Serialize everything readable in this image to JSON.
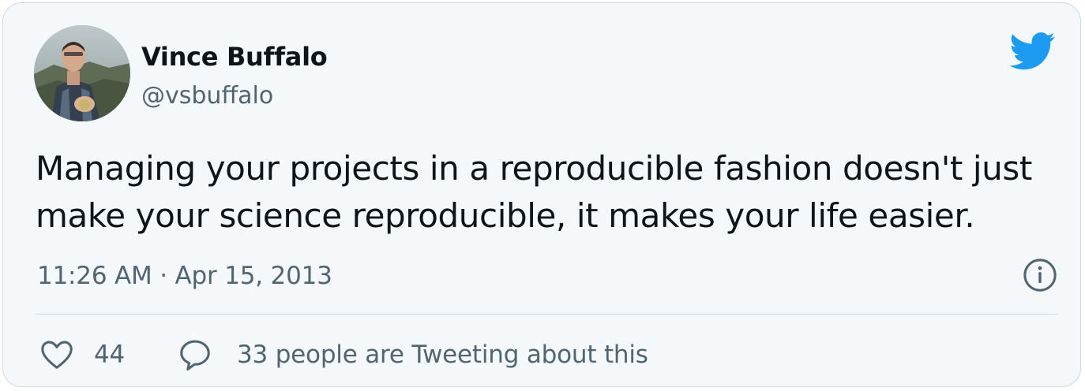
{
  "author": {
    "name": "Vince Buffalo",
    "handle": "@vsbuffalo"
  },
  "tweet": {
    "text": "Managing your projects in a reproducible fashion doesn't just\nmake your science reproducible, it makes your life easier.",
    "timestamp": "11:26 AM · Apr 15, 2013"
  },
  "actions": {
    "likes": "44",
    "conversation": "33 people are Tweeting about this"
  },
  "icons": {
    "brand": "twitter-bird-icon",
    "info": "info-icon",
    "like": "heart-icon",
    "reply": "reply-bubble-icon"
  },
  "colors": {
    "brand": "#1d9bf0",
    "text": "#0f1419",
    "secondary": "#536471",
    "card_background": "#f5f8fa",
    "border": "#cfd9de"
  }
}
